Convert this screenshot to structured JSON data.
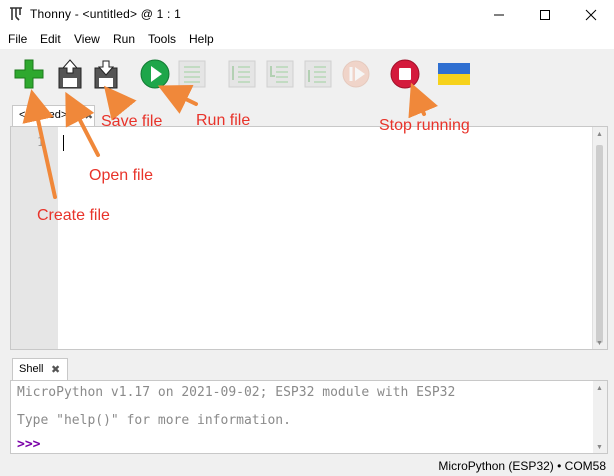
{
  "window": {
    "title": "Thonny  -  <untitled>  @  1 : 1",
    "app_icon": "thonny-logo-icon",
    "controls": [
      "minimize-icon",
      "maximize-icon",
      "close-icon"
    ]
  },
  "menu": {
    "items": [
      "File",
      "Edit",
      "View",
      "Run",
      "Tools",
      "Help"
    ]
  },
  "toolbar": {
    "buttons": [
      {
        "name": "new-file",
        "icon": "plus-icon",
        "color": "#2ea82e",
        "enabled": true
      },
      {
        "name": "open-file",
        "icon": "disk-upload-icon",
        "enabled": true
      },
      {
        "name": "save-file",
        "icon": "disk-download-icon",
        "enabled": true
      },
      {
        "name": "run",
        "icon": "play-icon",
        "color": "#1ea64a",
        "enabled": true
      },
      {
        "name": "debug",
        "icon": "debug-icon",
        "enabled": false
      },
      {
        "name": "step-over",
        "icon": "step-over-icon",
        "enabled": false
      },
      {
        "name": "step-into",
        "icon": "step-into-icon",
        "enabled": false
      },
      {
        "name": "step-out",
        "icon": "step-out-icon",
        "enabled": false
      },
      {
        "name": "resume",
        "icon": "resume-icon",
        "enabled": false
      },
      {
        "name": "stop",
        "icon": "stop-icon",
        "color": "#d41a3c",
        "enabled": true
      },
      {
        "name": "ukraine-flag",
        "icon": "ukraine-flag-icon",
        "colors": [
          "#2f6fd1",
          "#f6d21c"
        ]
      }
    ]
  },
  "editor": {
    "tab_label": "<untitled>",
    "line_numbers": [
      "1"
    ],
    "content": ""
  },
  "shell": {
    "tab_label": "Shell",
    "lines": [
      "MicroPython v1.17 on 2021-09-02; ESP32 module with ESP32",
      "Type \"help()\" for more information."
    ],
    "prompt": ">>>"
  },
  "status": {
    "text": "MicroPython (ESP32)  •  COM58"
  },
  "annotations": {
    "color": "#e8332a",
    "arrow_color": "#f0883a",
    "labels": {
      "create": "Create file",
      "open": "Open file",
      "save": "Save file",
      "run": "Run file",
      "stop": "Stop running"
    }
  }
}
